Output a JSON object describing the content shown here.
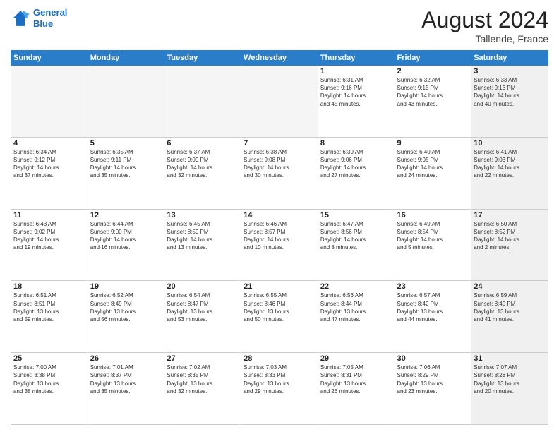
{
  "header": {
    "logo_line1": "General",
    "logo_line2": "Blue",
    "month": "August 2024",
    "location": "Tallende, France"
  },
  "days_of_week": [
    "Sunday",
    "Monday",
    "Tuesday",
    "Wednesday",
    "Thursday",
    "Friday",
    "Saturday"
  ],
  "weeks": [
    [
      {
        "day": "",
        "info": ""
      },
      {
        "day": "",
        "info": ""
      },
      {
        "day": "",
        "info": ""
      },
      {
        "day": "",
        "info": ""
      },
      {
        "day": "1",
        "info": "Sunrise: 6:31 AM\nSunset: 9:16 PM\nDaylight: 14 hours\nand 45 minutes."
      },
      {
        "day": "2",
        "info": "Sunrise: 6:32 AM\nSunset: 9:15 PM\nDaylight: 14 hours\nand 43 minutes."
      },
      {
        "day": "3",
        "info": "Sunrise: 6:33 AM\nSunset: 9:13 PM\nDaylight: 14 hours\nand 40 minutes."
      }
    ],
    [
      {
        "day": "4",
        "info": "Sunrise: 6:34 AM\nSunset: 9:12 PM\nDaylight: 14 hours\nand 37 minutes."
      },
      {
        "day": "5",
        "info": "Sunrise: 6:35 AM\nSunset: 9:11 PM\nDaylight: 14 hours\nand 35 minutes."
      },
      {
        "day": "6",
        "info": "Sunrise: 6:37 AM\nSunset: 9:09 PM\nDaylight: 14 hours\nand 32 minutes."
      },
      {
        "day": "7",
        "info": "Sunrise: 6:38 AM\nSunset: 9:08 PM\nDaylight: 14 hours\nand 30 minutes."
      },
      {
        "day": "8",
        "info": "Sunrise: 6:39 AM\nSunset: 9:06 PM\nDaylight: 14 hours\nand 27 minutes."
      },
      {
        "day": "9",
        "info": "Sunrise: 6:40 AM\nSunset: 9:05 PM\nDaylight: 14 hours\nand 24 minutes."
      },
      {
        "day": "10",
        "info": "Sunrise: 6:41 AM\nSunset: 9:03 PM\nDaylight: 14 hours\nand 22 minutes."
      }
    ],
    [
      {
        "day": "11",
        "info": "Sunrise: 6:43 AM\nSunset: 9:02 PM\nDaylight: 14 hours\nand 19 minutes."
      },
      {
        "day": "12",
        "info": "Sunrise: 6:44 AM\nSunset: 9:00 PM\nDaylight: 14 hours\nand 16 minutes."
      },
      {
        "day": "13",
        "info": "Sunrise: 6:45 AM\nSunset: 8:59 PM\nDaylight: 14 hours\nand 13 minutes."
      },
      {
        "day": "14",
        "info": "Sunrise: 6:46 AM\nSunset: 8:57 PM\nDaylight: 14 hours\nand 10 minutes."
      },
      {
        "day": "15",
        "info": "Sunrise: 6:47 AM\nSunset: 8:56 PM\nDaylight: 14 hours\nand 8 minutes."
      },
      {
        "day": "16",
        "info": "Sunrise: 6:49 AM\nSunset: 8:54 PM\nDaylight: 14 hours\nand 5 minutes."
      },
      {
        "day": "17",
        "info": "Sunrise: 6:50 AM\nSunset: 8:52 PM\nDaylight: 14 hours\nand 2 minutes."
      }
    ],
    [
      {
        "day": "18",
        "info": "Sunrise: 6:51 AM\nSunset: 8:51 PM\nDaylight: 13 hours\nand 59 minutes."
      },
      {
        "day": "19",
        "info": "Sunrise: 6:52 AM\nSunset: 8:49 PM\nDaylight: 13 hours\nand 56 minutes."
      },
      {
        "day": "20",
        "info": "Sunrise: 6:54 AM\nSunset: 8:47 PM\nDaylight: 13 hours\nand 53 minutes."
      },
      {
        "day": "21",
        "info": "Sunrise: 6:55 AM\nSunset: 8:46 PM\nDaylight: 13 hours\nand 50 minutes."
      },
      {
        "day": "22",
        "info": "Sunrise: 6:56 AM\nSunset: 8:44 PM\nDaylight: 13 hours\nand 47 minutes."
      },
      {
        "day": "23",
        "info": "Sunrise: 6:57 AM\nSunset: 8:42 PM\nDaylight: 13 hours\nand 44 minutes."
      },
      {
        "day": "24",
        "info": "Sunrise: 6:59 AM\nSunset: 8:40 PM\nDaylight: 13 hours\nand 41 minutes."
      }
    ],
    [
      {
        "day": "25",
        "info": "Sunrise: 7:00 AM\nSunset: 8:38 PM\nDaylight: 13 hours\nand 38 minutes."
      },
      {
        "day": "26",
        "info": "Sunrise: 7:01 AM\nSunset: 8:37 PM\nDaylight: 13 hours\nand 35 minutes."
      },
      {
        "day": "27",
        "info": "Sunrise: 7:02 AM\nSunset: 8:35 PM\nDaylight: 13 hours\nand 32 minutes."
      },
      {
        "day": "28",
        "info": "Sunrise: 7:03 AM\nSunset: 8:33 PM\nDaylight: 13 hours\nand 29 minutes."
      },
      {
        "day": "29",
        "info": "Sunrise: 7:05 AM\nSunset: 8:31 PM\nDaylight: 13 hours\nand 26 minutes."
      },
      {
        "day": "30",
        "info": "Sunrise: 7:06 AM\nSunset: 8:29 PM\nDaylight: 13 hours\nand 23 minutes."
      },
      {
        "day": "31",
        "info": "Sunrise: 7:07 AM\nSunset: 8:28 PM\nDaylight: 13 hours\nand 20 minutes."
      }
    ]
  ]
}
